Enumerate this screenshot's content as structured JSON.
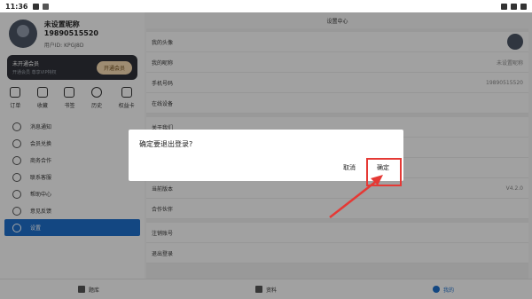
{
  "status_bar": {
    "time": "11:36"
  },
  "profile": {
    "name": "未设置昵称 19890515520",
    "uid": "用户ID: KPGJ8D"
  },
  "vip": {
    "title": "未开通会员",
    "subtitle": "开通会员 尊享VIP特权",
    "button": "开通会员"
  },
  "quick_actions": [
    {
      "label": "订单",
      "icon": "order-icon"
    },
    {
      "label": "收藏",
      "icon": "star-icon"
    },
    {
      "label": "书签",
      "icon": "bookmark-icon"
    },
    {
      "label": "历史",
      "icon": "history-icon"
    },
    {
      "label": "权益卡",
      "icon": "card-icon"
    }
  ],
  "menu": [
    {
      "label": "消息通知",
      "icon": "bell-icon"
    },
    {
      "label": "会员兑换",
      "icon": "gift-icon"
    },
    {
      "label": "商务合作",
      "icon": "handshake-icon"
    },
    {
      "label": "联系客服",
      "icon": "headset-icon"
    },
    {
      "label": "帮助中心",
      "icon": "help-icon"
    },
    {
      "label": "意见反馈",
      "icon": "feedback-icon"
    },
    {
      "label": "设置",
      "icon": "gear-icon",
      "active": true
    }
  ],
  "settings": {
    "title": "设置中心",
    "rows_top": [
      {
        "label": "我的头像",
        "value": ""
      },
      {
        "label": "我的昵称",
        "value": "未设置昵称"
      },
      {
        "label": "手机号码",
        "value": "19890515520"
      },
      {
        "label": "在线设备",
        "value": ""
      }
    ],
    "rows_mid": [
      {
        "label": "关于我们",
        "value": ""
      }
    ],
    "rows_bottom": [
      {
        "label": "当前版本",
        "value": "V4.2.0"
      },
      {
        "label": "合作伙伴",
        "value": ""
      }
    ],
    "rows_end": [
      {
        "label": "注销账号",
        "value": ""
      },
      {
        "label": "退出登录",
        "value": ""
      }
    ]
  },
  "bottom_tabs": [
    {
      "label": "题库",
      "icon": "grid-icon"
    },
    {
      "label": "资料",
      "icon": "doc-icon"
    },
    {
      "label": "我的",
      "icon": "user-icon",
      "active": true
    }
  ],
  "dialog": {
    "message": "确定要退出登录?",
    "cancel": "取消",
    "confirm": "确定"
  },
  "colors": {
    "accent": "#1e6ec8",
    "highlight": "#e53935"
  }
}
